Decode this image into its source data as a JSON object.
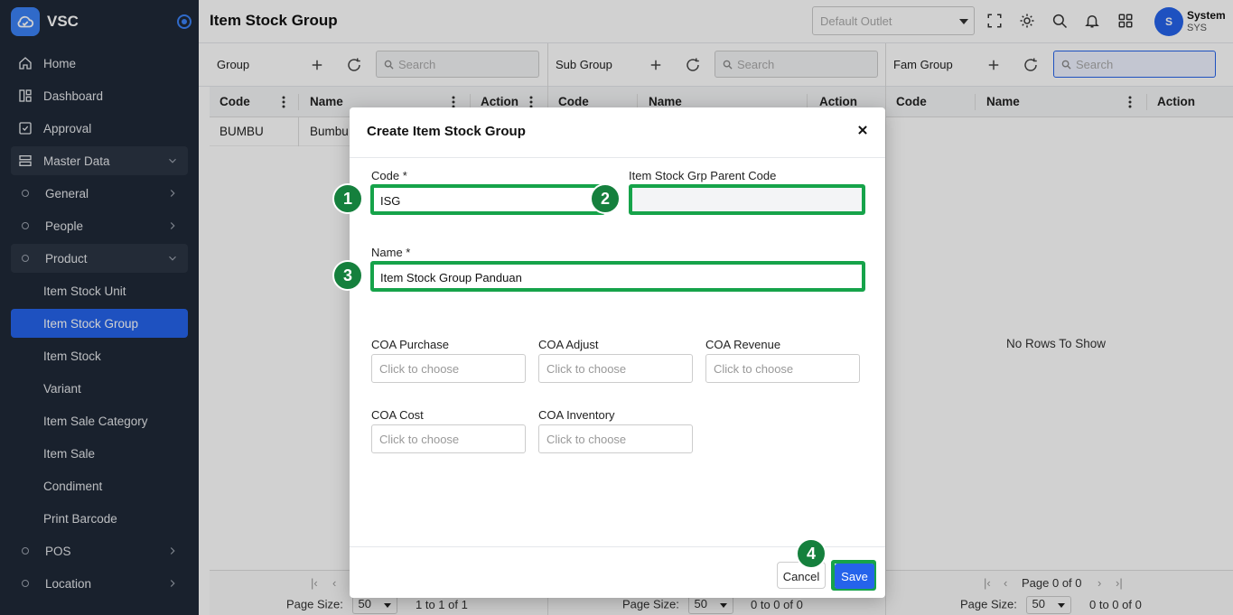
{
  "app": {
    "name": "VSC"
  },
  "sidebar": {
    "items": [
      {
        "label": "Home"
      },
      {
        "label": "Dashboard"
      },
      {
        "label": "Approval"
      },
      {
        "label": "Master Data"
      },
      {
        "label": "General"
      },
      {
        "label": "People"
      },
      {
        "label": "Product"
      },
      {
        "label": "Item Stock Unit"
      },
      {
        "label": "Item Stock Group"
      },
      {
        "label": "Item Stock"
      },
      {
        "label": "Variant"
      },
      {
        "label": "Item Sale Category"
      },
      {
        "label": "Item Sale"
      },
      {
        "label": "Condiment"
      },
      {
        "label": "Print Barcode"
      },
      {
        "label": "POS"
      },
      {
        "label": "Location"
      }
    ]
  },
  "header": {
    "title": "Item Stock Group",
    "outlet_placeholder": "Default Outlet",
    "user": {
      "initial": "S",
      "name": "System",
      "code": "SYS"
    }
  },
  "panels": {
    "group": {
      "title": "Group",
      "search_placeholder": "Search",
      "columns": [
        "Code",
        "Name",
        "Action"
      ],
      "rows": [
        {
          "code": "BUMBU",
          "name": "Bumbu"
        }
      ],
      "page_size_label": "Page Size:",
      "page_size": "50",
      "count": "1 to 1 of 1"
    },
    "subgroup": {
      "title": "Sub Group",
      "search_placeholder": "Search",
      "columns": [
        "Code",
        "Name",
        "Action"
      ],
      "page_size_label": "Page Size:",
      "page_size": "50",
      "count": "0 to 0 of 0"
    },
    "famgroup": {
      "title": "Fam Group",
      "search_placeholder": "Search",
      "columns": [
        "Code",
        "Name",
        "Action"
      ],
      "empty": "No Rows To Show",
      "pager": "Page 0 of 0",
      "page_size_label": "Page Size:",
      "page_size": "50",
      "count": "0 to 0 of 0"
    }
  },
  "modal": {
    "title": "Create Item Stock Group",
    "code_label": "Code *",
    "code_value": "ISG",
    "parent_label": "Item Stock Grp Parent Code",
    "parent_value": "",
    "name_label": "Name *",
    "name_value": "Item Stock Group Panduan",
    "coa": [
      {
        "label": "COA Purchase",
        "placeholder": "Click to choose"
      },
      {
        "label": "COA Adjust",
        "placeholder": "Click to choose"
      },
      {
        "label": "COA Revenue",
        "placeholder": "Click to choose"
      },
      {
        "label": "COA Cost",
        "placeholder": "Click to choose"
      },
      {
        "label": "COA Inventory",
        "placeholder": "Click to choose"
      }
    ],
    "cancel_label": "Cancel",
    "save_label": "Save"
  },
  "annotations": {
    "badges": [
      "1",
      "2",
      "3",
      "4"
    ],
    "highlight_color": "#16a34a"
  },
  "colors": {
    "accent": "#2563eb",
    "sidebar": "#1f2937"
  }
}
